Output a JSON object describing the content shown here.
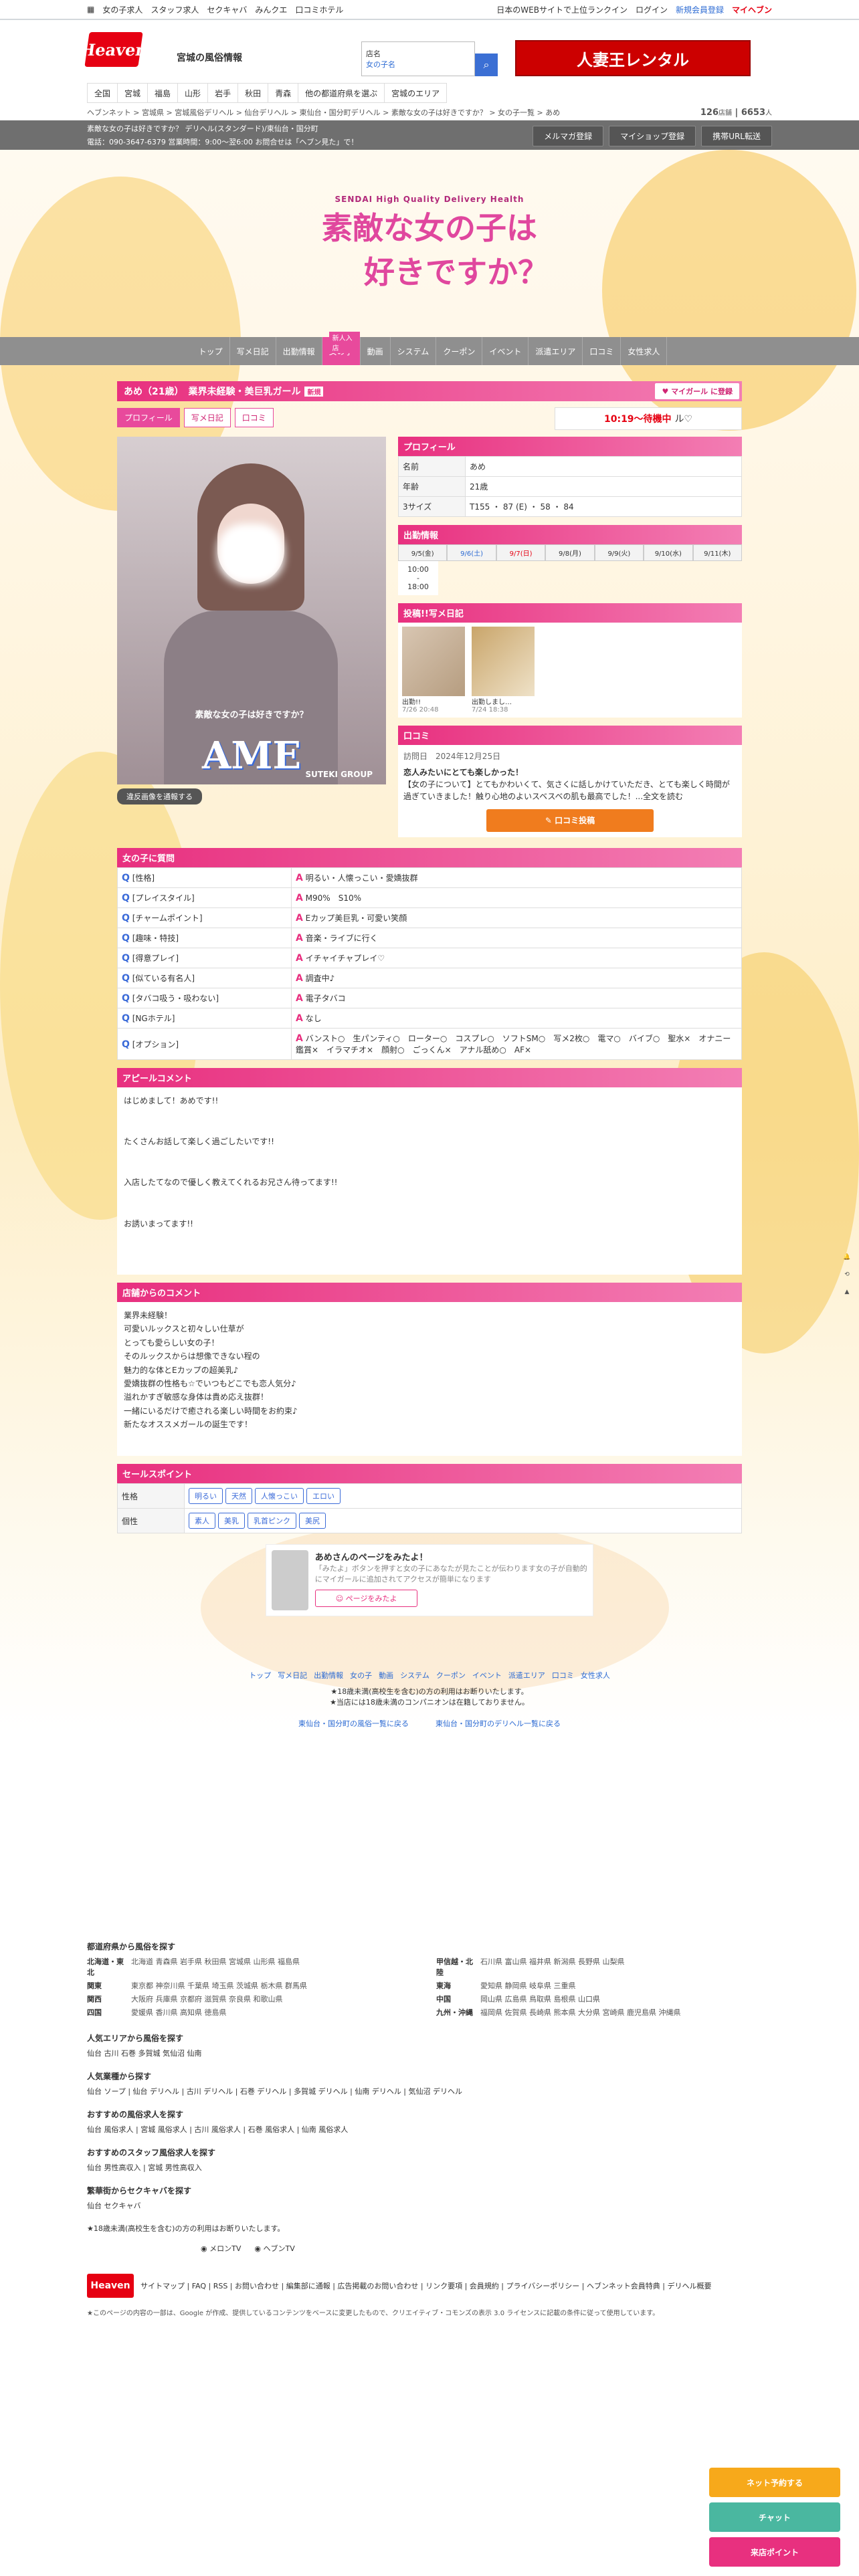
{
  "topbar": {
    "links": [
      "女の子求人",
      "スタッフ求人",
      "セクキャバ",
      "みんクエ",
      "口コミホテル"
    ],
    "right": [
      "日本のWEBサイトで上位ランクイン",
      "ログイン",
      "新規会員登録",
      "マイヘブン"
    ]
  },
  "header": {
    "logo": "Heaven",
    "pref": "宮城の風俗情報",
    "search_label": "店名",
    "search_value": "女の子名",
    "banner": "人妻王レンタル"
  },
  "nav2": [
    "全国",
    "宮城",
    "福島",
    "山形",
    "岩手",
    "秋田",
    "青森",
    "他の都道府県を選ぶ",
    "宮城のエリア"
  ],
  "breadcrumb": {
    "text": "ヘブンネット > 宮城県 > 宮城風俗デリヘル > 仙台デリヘル > 東仙台・国分町デリヘル > 素敵な女の子は好きですか？ > 女の子一覧 > あめ",
    "count1": "126",
    "count1_unit": "店舗",
    "count2": "6653",
    "count2_unit": "人"
  },
  "greybar": {
    "line1": "素敵な女の子は好きですか？ デリヘル(スタンダード)/東仙台・国分町",
    "line2": "電話：090-3647-6379 営業時間：9:00〜翌6:00 お問合せは「ヘブン見た」で！",
    "btn1": "メルマガ登録",
    "btn2": "マイショップ登録",
    "btn3": "携帯URL転送"
  },
  "hero": {
    "sub": "SENDAI High Quality Delivery Health",
    "title1": "素敵な女の子は",
    "title2": "好きですか？"
  },
  "gnav": {
    "items": [
      "トップ",
      "写メ日記",
      "出勤情報",
      "女の子",
      "動画",
      "システム",
      "クーポン",
      "イベント",
      "派遣エリア",
      "口コミ",
      "女性求人"
    ],
    "badge": "新人入店"
  },
  "girl": {
    "title": "あめ（21歳）　業界未経験・美巨乳ガール",
    "tag": "新規",
    "mgbtn": "マイガール に登録"
  },
  "tabs": [
    "プロフィール",
    "写メ日記",
    "口コミ"
  ],
  "time_label": "10:19〜待機中",
  "time_suffix": "ル♡",
  "photo": {
    "name": "AME",
    "group": "SUTEKI GROUP",
    "caption": "素敵な女の子は好きですか？"
  },
  "report": "違反画像を通報する",
  "profile": {
    "header": "プロフィール",
    "rows": [
      [
        "名前",
        "あめ"
      ],
      [
        "年齢",
        "21歳"
      ],
      [
        "3サイズ",
        "T155 ・ 87 (E) ・ 58 ・ 84"
      ]
    ]
  },
  "schedule": {
    "header": "出勤情報",
    "days": [
      "9/5(金)",
      "9/6(土)",
      "9/7(日)",
      "9/8(月)",
      "9/9(火)",
      "9/10(水)",
      "9/11(木)"
    ],
    "times": [
      "10:00",
      "18:00"
    ]
  },
  "diary": {
    "header": "投稿!!写メ日記",
    "items": [
      {
        "t": "出勤!!",
        "d": "7/26 20:48"
      },
      {
        "t": "出勤しまし…",
        "d": "7/24 18:38"
      }
    ]
  },
  "review": {
    "header": "口コミ",
    "date": "訪問日　2024年12月25日",
    "title": "恋人みたいにとても楽しかった！",
    "body": "【女の子について】とてもかわいくて、気さくに話しかけていただき、とても楽しく時間が過ぎていきました！触り心地のよいスベスベの肌も最高でした！...全文を読む",
    "btn": "口コミ投稿"
  },
  "qa": {
    "header": "女の子に質問",
    "items": [
      [
        "[性格]",
        "明るい・人懐っこい・愛嬌抜群"
      ],
      [
        "[プレイスタイル]",
        "M90%　S10%"
      ],
      [
        "[チャームポイント]",
        "Eカップ美巨乳・可愛い笑顔"
      ],
      [
        "[趣味・特技]",
        "音楽・ライブに行く"
      ],
      [
        "[得意プレイ]",
        "イチャイチャプレイ♡"
      ],
      [
        "[似ている有名人]",
        "調査中♪"
      ],
      [
        "[タバコ吸う・吸わない]",
        "電子タバコ"
      ],
      [
        "[NGホテル]",
        "なし"
      ],
      [
        "[オプション]",
        "バンスト○　生パンティ○　ローター○　コスプレ○　ソフトSM○　写メ2枚○　電マ○　バイブ○　聖水×　オナニー鑑賞×　イラマチオ×　顔射○　ごっくん×　アナル舐め○　AF×"
      ]
    ]
  },
  "appeal": {
    "header": "アピールコメント",
    "text": "はじめまして！あめです!!\n\n\nたくさんお話して楽しく過ごしたいです!!\n\n\n入店したてなので優しく教えてくれるお兄さん待ってます!!\n\n\nお誘いまってます!!"
  },
  "shop": {
    "header": "店舗からのコメント",
    "text": "業界未経験！\n可愛いルックスと初々しい仕草が\nとっても愛らしい女の子！\nそのルックスからは想像できない程の\n魅力的な体とEカップの超美乳♪\n愛嬌抜群の性格も☆でいつもどこでも恋人気分♪\n溢れかすぎ敏感な身体は貴め応え抜群！\n一緒にいるだけで癒される楽しい時間をお約束♪\n新たなオススメガールの誕生です！"
  },
  "points": {
    "header": "セールスポイント",
    "k1": "性格",
    "v1": [
      "明るい",
      "天然",
      "人懐っこい",
      "エロい"
    ],
    "k2": "個性",
    "v2": [
      "素人",
      "美乳",
      "乳首ピンク",
      "美尻"
    ]
  },
  "cta": {
    "title": "あめさんのページをみたよ！",
    "desc": "「みたよ」ボタンを押すと女の子にあなたが見たことが伝わります女の子が自動的にマイガールに追加されてアクセスが簡単になります",
    "btn": "ページをみたよ"
  },
  "fnav": [
    "トップ",
    "写メ日記",
    "出勤情報",
    "女の子",
    "動画",
    "システム",
    "クーポン",
    "イベント",
    "派遣エリア",
    "口コミ",
    "女性求人"
  ],
  "notice1": "★18歳未満(高校生を含む)の方の利用はお断りいたします。",
  "notice2": "★当店には18歳未満のコンパニオンは在籍しておりません。",
  "links": [
    "東仙台・国分町の風俗一覧に戻る",
    "東仙台・国分町のデリヘル一覧に戻る"
  ],
  "footer": {
    "h1": "都道府県から風俗を探す",
    "regions": [
      [
        "北海道・東北",
        "北海道 青森県 岩手県 秋田県 宮城県 山形県 福島県"
      ],
      [
        "関東",
        "東京都 神奈川県 千葉県 埼玉県 茨城県 栃木県 群馬県"
      ],
      [
        "関西",
        "大阪府 兵庫県 京都府 滋賀県 奈良県 和歌山県"
      ],
      [
        "四国",
        "愛媛県 香川県 高知県 徳島県"
      ]
    ],
    "regions2": [
      [
        "甲信越・北陸",
        "石川県 富山県 福井県 新潟県 長野県 山梨県"
      ],
      [
        "東海",
        "愛知県 静岡県 岐阜県 三重県"
      ],
      [
        "中国",
        "岡山県 広島県 鳥取県 島根県 山口県"
      ],
      [
        "九州・沖縄",
        "福岡県 佐賀県 長崎県 熊本県 大分県 宮崎県 鹿児島県 沖縄県"
      ]
    ],
    "h2": "人気エリアから風俗を探す",
    "a2": "仙台 古川 石巻 多賀城 気仙沼 仙南",
    "h3": "人気業種から探す",
    "a3": "仙台 ソープ | 仙台 デリヘル | 古川 デリヘル | 石巻 デリヘル | 多賀城 デリヘル | 仙南 デリヘル | 気仙沼 デリヘル",
    "h4": "おすすめの風俗求人を探す",
    "a4": "仙台 風俗求人 | 宮城 風俗求人 | 古川 風俗求人 | 石巻 風俗求人 | 仙南 風俗求人",
    "h5": "おすすめのスタッフ風俗求人を探す",
    "a5": "仙台 男性高収入 | 宮城 男性高収入",
    "h6": "繁華街からセクキャバを探す",
    "a6": "仙台 セクキャバ",
    "notice": "★18歳未満(高校生を含む)の方の利用はお断りいたします。",
    "apps": [
      "メロンTV",
      "ヘブンTV"
    ],
    "bottom": "サイトマップ | FAQ | RSS | お問い合わせ | 編集部に通報 | 広告掲載のお問い合わせ | リンク要項 | 会員規約 | プライバシーポリシー | ヘブンネット会員特典 | デリヘル概要",
    "legal": "★このページの内容の一部は、Google が作成、提供しているコンテンツをベースに変更したもので、クリエイティブ・コモンズの表示 3.0 ライセンスに記載の条件に従って使用しています。"
  },
  "side": {
    "b1": "ネット予約する",
    "b2": "チャット",
    "b3": "来店ポイント"
  },
  "colors": {
    "pink": "#e8307f",
    "orange": "#f07c1e",
    "teal": "#4ab7a0"
  }
}
